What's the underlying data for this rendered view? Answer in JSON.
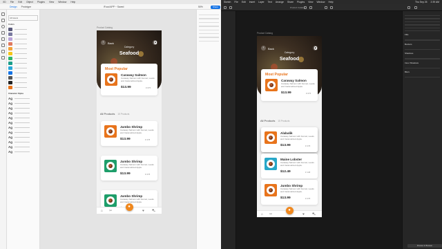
{
  "xd": {
    "menu": [
      "XD",
      "File",
      "Edit",
      "Object",
      "Plugins",
      "View",
      "Window",
      "Help"
    ],
    "tabs": [
      "Design",
      "Prototype"
    ],
    "document_title": "iFood APP ~ Saved",
    "zoom": "50%",
    "share_label": "Share",
    "assets_search": "All Assets",
    "colors_heading": "Colors",
    "char_styles_heading": "Character Styles",
    "color_swatches": [
      "#5a5a7a",
      "#7a7aa0",
      "#b9a3d8",
      "#e07a5f",
      "#f2a23a",
      "#f5c518",
      "#2fb56b",
      "#1a9e8a",
      "#28a7d8",
      "#1473e6",
      "#555555",
      "#222222",
      "#e8741c"
    ]
  },
  "artboard_label": "Product Catalog",
  "phone": {
    "back_label": "Back",
    "category_label": "Category",
    "category_title": "Seafood",
    "most_popular_label": "Most Popular",
    "all_products_label": "All Products",
    "products_count": "15 Products"
  },
  "xd_phone": {
    "popular": {
      "name": "Caraway Salmon",
      "desc": "Caraway Salmon with Fennel, Leeks and Caramelized Apple.",
      "price": "$13.99",
      "likes": "675",
      "tile_color": "#e8741c"
    },
    "items": [
      {
        "name": "Jumbo Shrimp",
        "desc": "Caraway Salmon with Fennel, Leeks and Caramelized Apple.",
        "price": "$13.99",
        "likes": "278",
        "tile_color": "#e8741c"
      },
      {
        "name": "Jumbo Shrimp",
        "desc": "Caraway Salmon with Fennel, Leeks and Caramelized Apple.",
        "price": "$13.99",
        "likes": "278",
        "tile_color": "#1e9e6a"
      },
      {
        "name": "Jumbo Shrimp",
        "desc": "Caraway Salmon with Fennel, Leeks and Caramelized Apple.",
        "price": "$13.99",
        "likes": "278",
        "tile_color": "#1e9e6a"
      }
    ]
  },
  "sk_phone": {
    "popular": {
      "name": "Caraway Salmon",
      "desc": "Caraway Salmon with Fennel, Leeks and Caramelized Apple.",
      "price": "$13.99",
      "likes": "675",
      "tile_color": "#e8741c"
    },
    "items": [
      {
        "name": "Alabalik",
        "desc": "Caraway Salmon with Fennel, Leeks and Caramelized Apple.",
        "price": "$13.99",
        "likes": "278",
        "tile_color": "#e8741c"
      },
      {
        "name": "Maine Lobster",
        "desc": "Caraway Salmon with Fennel, Leeks and Caramelized Apple.",
        "price": "$12.49",
        "likes": "148",
        "tile_color": "#28a7c8"
      },
      {
        "name": "Jumbo Shrimp",
        "desc": "Caraway Salmon with Fennel, Leeks and Caramelized Apple.",
        "price": "$13.99",
        "likes": "278",
        "tile_color": "#e8741c"
      }
    ]
  },
  "sketch": {
    "menu": [
      "Sketch",
      "File",
      "Edit",
      "Insert",
      "Layer",
      "Text",
      "Arrange",
      "Share",
      "Plugins",
      "View",
      "Window",
      "Help"
    ],
    "status": [
      "Thu Sep 26",
      "2:39 AM"
    ],
    "document_title": "Product Catalog",
    "inspector": [
      "Fills",
      "Borders",
      "Shadows",
      "Inner Shadows",
      "Blurs"
    ],
    "preview_label": "Preview in Browser"
  },
  "icons": [
    "back-arrow-icon",
    "search-icon",
    "heart-icon",
    "home-icon",
    "tools-icon",
    "user-icon",
    "cart-icon"
  ]
}
